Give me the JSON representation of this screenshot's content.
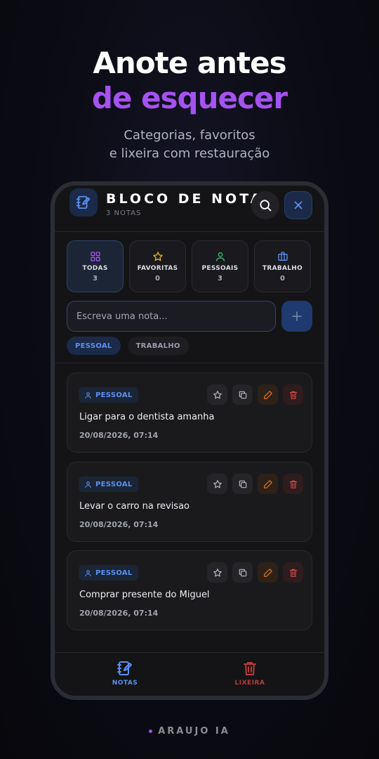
{
  "hero": {
    "line1": "Anote antes",
    "line2": "de esquecer",
    "sub1": "Categorias, favoritos",
    "sub2": "e lixeira com restauração"
  },
  "app": {
    "title": "BLOCO DE NOTAS",
    "subtitle": "3 NOTAS"
  },
  "categories": [
    {
      "label": "TODAS",
      "count": "3",
      "icon": "grid-icon",
      "color": "#a552f0"
    },
    {
      "label": "FAVORITAS",
      "count": "0",
      "icon": "star-icon",
      "color": "#e6b422"
    },
    {
      "label": "PESSOAIS",
      "count": "3",
      "icon": "user-icon",
      "color": "#3fbf7f"
    },
    {
      "label": "TRABALHO",
      "count": "0",
      "icon": "briefcase-icon",
      "color": "#5b8ff0"
    }
  ],
  "input": {
    "placeholder": "Escreva uma nota..."
  },
  "chips": [
    {
      "label": "PESSOAL"
    },
    {
      "label": "TRABALHO"
    }
  ],
  "notes": [
    {
      "tag": "PESSOAL",
      "text": "Ligar para o dentista amanha",
      "date": "20/08/2026, 07:14"
    },
    {
      "tag": "PESSOAL",
      "text": "Levar o carro na revisao",
      "date": "20/08/2026, 07:14"
    },
    {
      "tag": "PESSOAL",
      "text": "Comprar presente do Miguel",
      "date": "20/08/2026, 07:14"
    }
  ],
  "nav": {
    "notes": "NOTAS",
    "trash": "LIXEIRA"
  },
  "footer": "ARAUJO IA",
  "colors": {
    "accent": "#a552f0",
    "blue": "#5b8ff0",
    "danger": "#b83a3a",
    "edit": "#e0782f"
  }
}
